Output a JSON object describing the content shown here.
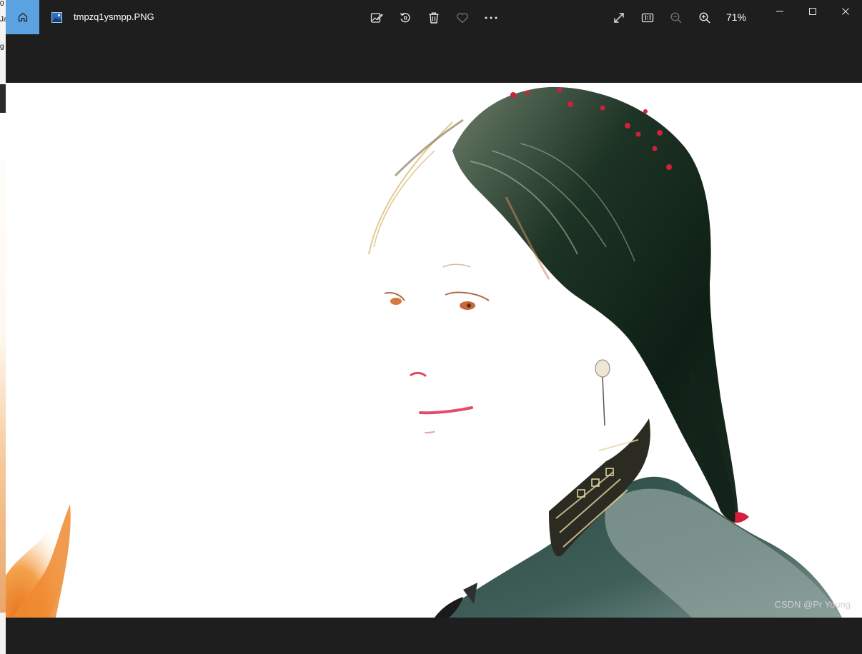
{
  "window": {
    "file_name": "tmpzq1ysmpp.PNG",
    "zoom_level": "71%"
  },
  "left_strip": {
    "glyph_a": "0",
    "glyph_b": "Ja",
    "glyph_c": "g"
  },
  "toolbar": {
    "icons": [
      "edit-image-icon",
      "rotate-icon",
      "delete-icon",
      "favorite-heart-icon",
      "more-options-icon",
      "fullscreen-icon",
      "actual-size-icon",
      "zoom-out-icon",
      "zoom-in-icon"
    ]
  },
  "window_controls": {
    "icons": [
      "minimize-icon",
      "maximize-icon",
      "close-icon"
    ]
  },
  "photo": {
    "subject": "portrait"
  },
  "watermark": "CSDN @Pr Young",
  "colors": {
    "background": "#1e1e1e",
    "home_accent": "#5aa2e0"
  }
}
